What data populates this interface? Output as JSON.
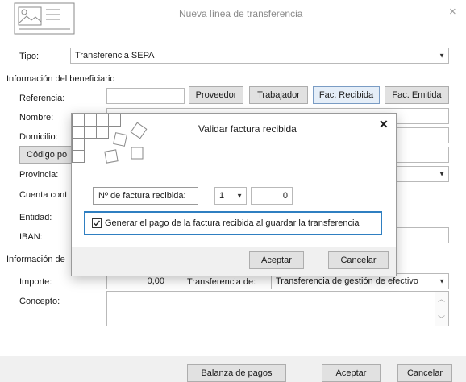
{
  "window": {
    "title": "Nueva línea de transferencia",
    "close_symbol": "×"
  },
  "tipo": {
    "label": "Tipo:",
    "value": "Transferencia SEPA"
  },
  "beneficiary": {
    "section_title": "Información del beneficiario",
    "referencia_label": "Referencia:",
    "nombre_label": "Nombre:",
    "domicilio_label": "Domicilio:",
    "codigo_button": "Código po",
    "provincia_label": "Provincia:",
    "cuenta_label": "Cuenta cont",
    "entidad_label": "Entidad:",
    "iban_label": "IBAN:",
    "buttons": {
      "proveedor": "Proveedor",
      "trabajador": "Trabajador",
      "fac_recibida": "Fac. Recibida",
      "fac_emitida": "Fac. Emitida"
    }
  },
  "operation": {
    "section_title": "Información de",
    "importe_label": "Importe:",
    "importe_value": "0,00",
    "transferencia_label": "Transferencia de:",
    "transferencia_value": "Transferencia de gestión de efectivo",
    "concepto_label": "Concepto:"
  },
  "footer": {
    "balanza": "Balanza de pagos",
    "aceptar": "Aceptar",
    "cancelar": "Cancelar"
  },
  "dialog": {
    "title": "Validar factura recibida",
    "close_symbol": "✕",
    "factura_label": "Nº de factura recibida:",
    "serie_value": "1",
    "numero_value": "0",
    "checkbox_label": "Generar el pago de la factura recibida al guardar la transferencia",
    "checkbox_checked": true,
    "aceptar": "Aceptar",
    "cancelar": "Cancelar"
  }
}
